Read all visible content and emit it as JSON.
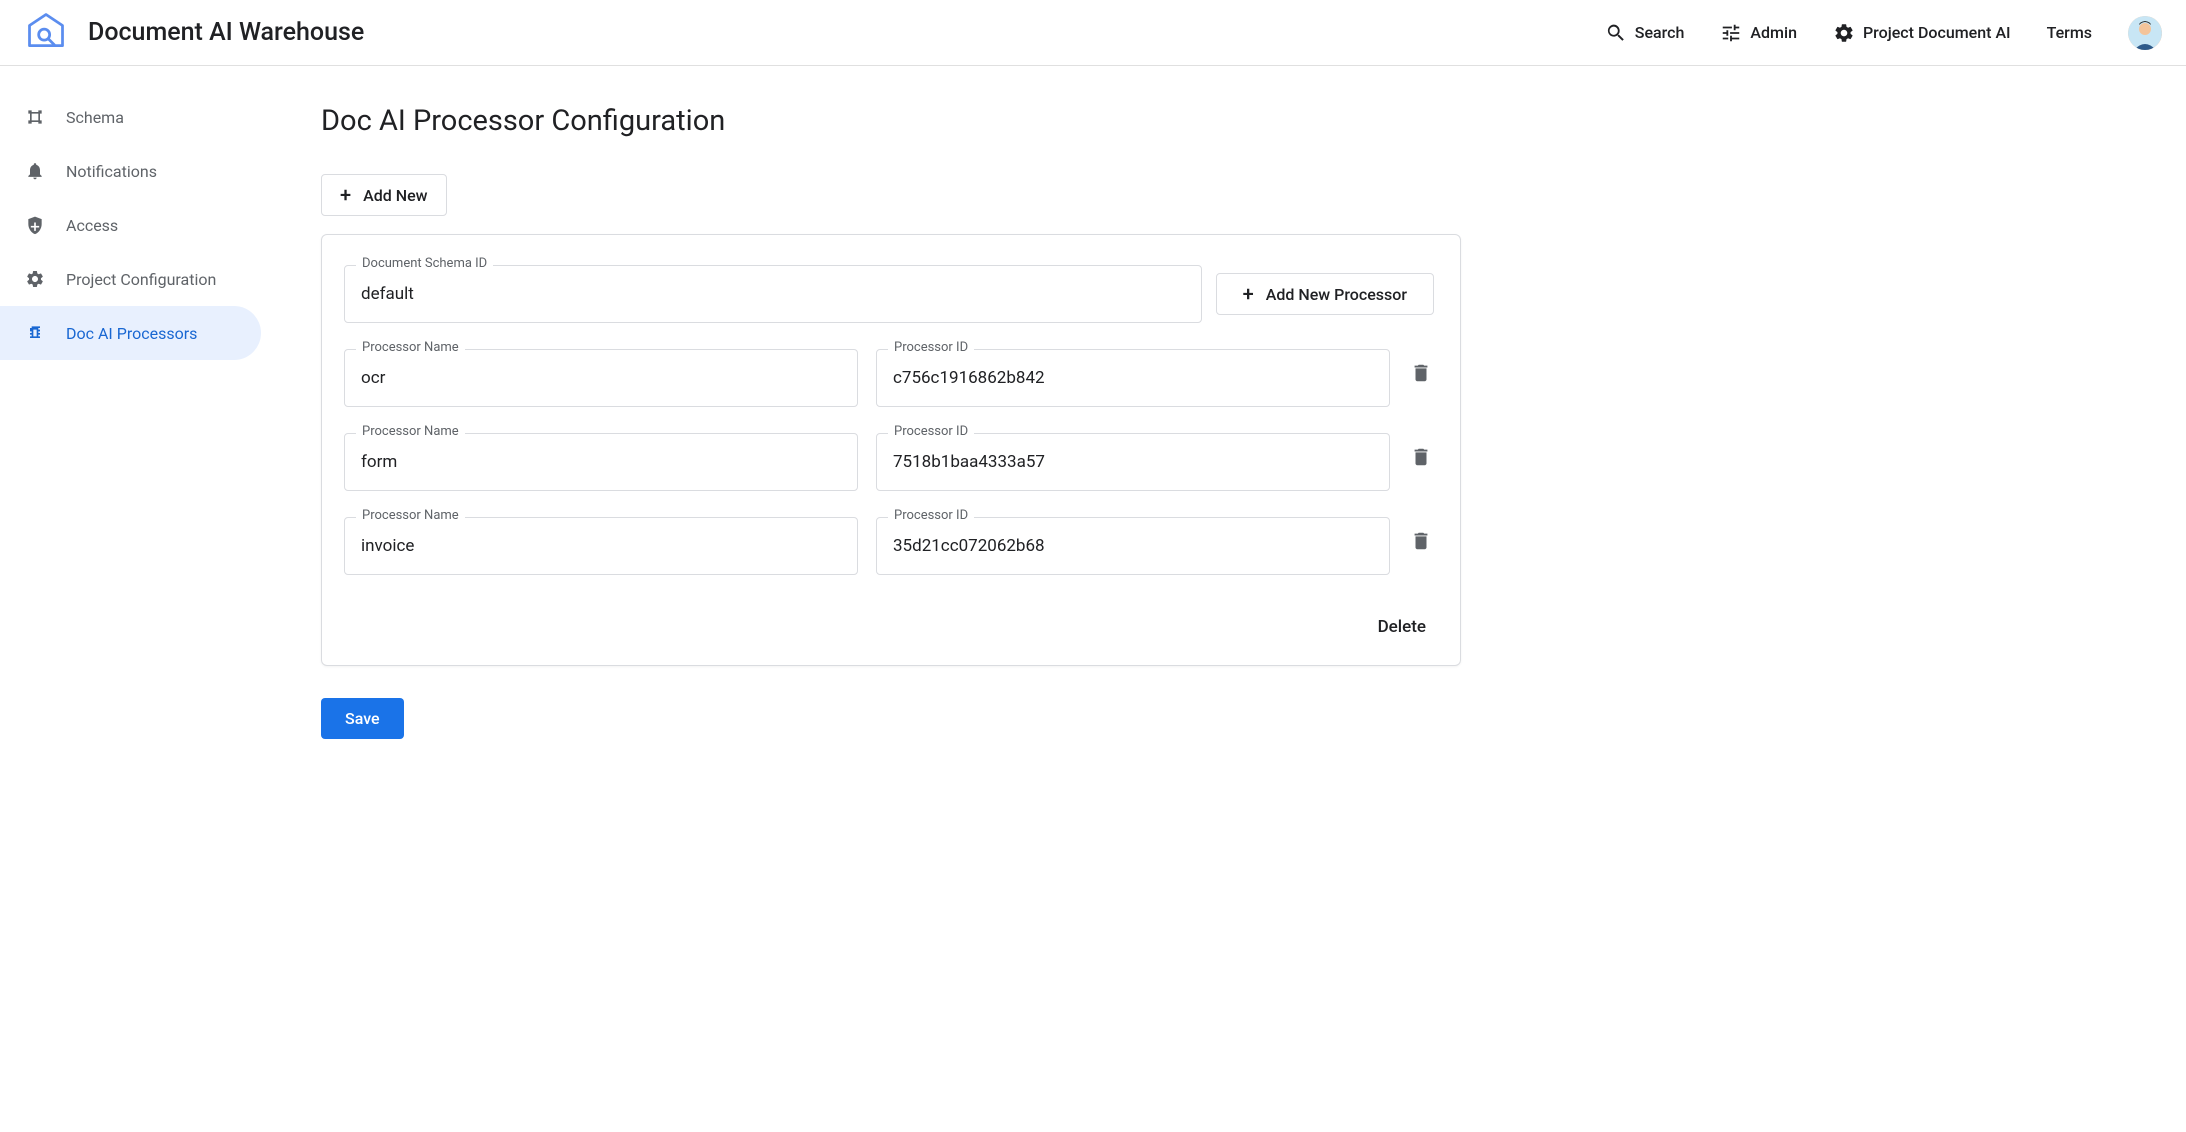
{
  "header": {
    "title": "Document AI Warehouse",
    "nav": {
      "search": "Search",
      "admin": "Admin",
      "project": "Project Document AI",
      "terms": "Terms"
    }
  },
  "sidebar": {
    "items": [
      {
        "label": "Schema"
      },
      {
        "label": "Notifications"
      },
      {
        "label": "Access"
      },
      {
        "label": "Project Configuration"
      },
      {
        "label": "Doc AI Processors"
      }
    ]
  },
  "main": {
    "title": "Doc AI Processor Configuration",
    "add_new_label": "Add New",
    "add_processor_label": "Add New Processor",
    "schema_id_label": "Document Schema ID",
    "schema_id_value": "default",
    "processor_name_label": "Processor Name",
    "processor_id_label": "Processor ID",
    "processors": [
      {
        "name": "ocr",
        "id": "c756c1916862b842"
      },
      {
        "name": "form",
        "id": "7518b1baa4333a57"
      },
      {
        "name": "invoice",
        "id": "35d21cc072062b68"
      }
    ],
    "delete_label": "Delete",
    "save_label": "Save"
  }
}
